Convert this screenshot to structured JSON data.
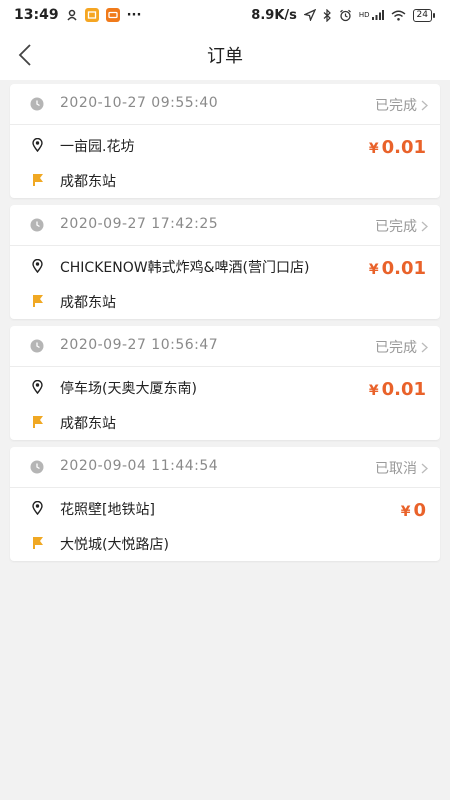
{
  "status_bar": {
    "time": "13:49",
    "network_speed": "8.9K/s",
    "signal": "HD",
    "battery": "24"
  },
  "header": {
    "title": "订单"
  },
  "orders": [
    {
      "datetime": "2020-10-27 09:55:40",
      "status": "已完成",
      "from": "一亩园.花坊",
      "to": "成都东站",
      "currency": "¥",
      "amount": "0.01"
    },
    {
      "datetime": "2020-09-27 17:42:25",
      "status": "已完成",
      "from": "CHICKENOW韩式炸鸡&啤酒(营门口店)",
      "to": "成都东站",
      "currency": "¥",
      "amount": "0.01"
    },
    {
      "datetime": "2020-09-27 10:56:47",
      "status": "已完成",
      "from": "停车场(天奥大厦东南)",
      "to": "成都东站",
      "currency": "¥",
      "amount": "0.01"
    },
    {
      "datetime": "2020-09-04 11:44:54",
      "status": "已取消",
      "from": "花照壁[地铁站]",
      "to": "大悦城(大悦路店)",
      "currency": "¥",
      "amount": "0"
    }
  ],
  "colors": {
    "accent": "#e9622a",
    "flag": "#f0a823",
    "muted": "#8a8a8a"
  }
}
